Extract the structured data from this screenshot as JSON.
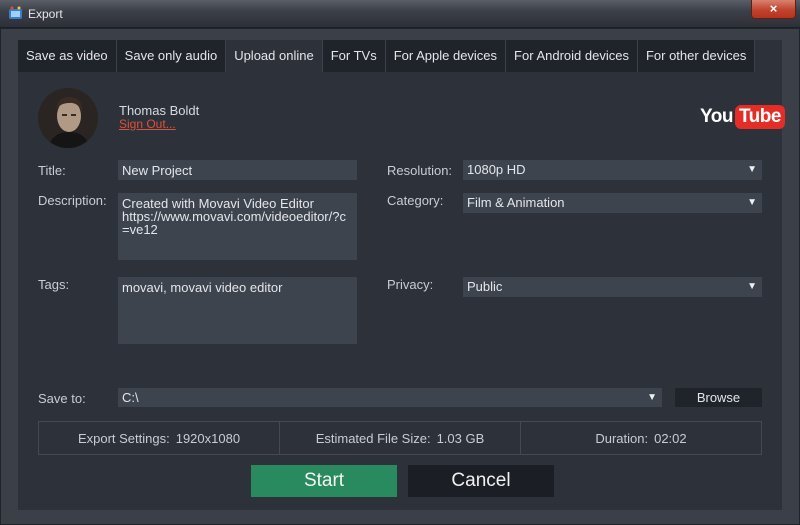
{
  "window": {
    "title": "Export",
    "close_symbol": "×"
  },
  "tabs": [
    {
      "label": "Save as video",
      "active": false
    },
    {
      "label": "Save only audio",
      "active": false
    },
    {
      "label": "Upload online",
      "active": true
    },
    {
      "label": "For TVs",
      "active": false
    },
    {
      "label": "For Apple devices",
      "active": false
    },
    {
      "label": "For Android devices",
      "active": false
    },
    {
      "label": "For other devices",
      "active": false
    }
  ],
  "account": {
    "name": "Thomas Boldt",
    "sign_out": "Sign Out..."
  },
  "service": {
    "logo_you": "You",
    "logo_tube": "Tube"
  },
  "form": {
    "title_label": "Title:",
    "title_value": "New Project",
    "description_label": "Description:",
    "description_value": "Created with Movavi Video Editor\nhttps://www.movavi.com/videoeditor/?c=ve12",
    "tags_label": "Tags:",
    "tags_value": "movavi, movavi video editor",
    "resolution_label": "Resolution:",
    "resolution_value": "1080p HD",
    "category_label": "Category:",
    "category_value": "Film & Animation",
    "privacy_label": "Privacy:",
    "privacy_value": "Public",
    "save_to_label": "Save to:",
    "save_to_value": "C:\\",
    "browse_label": "Browse"
  },
  "info": {
    "export_settings_label": "Export Settings:",
    "export_settings_value": "1920x1080",
    "file_size_label": "Estimated File Size:",
    "file_size_value": "1.03 GB",
    "duration_label": "Duration:",
    "duration_value": "02:02"
  },
  "buttons": {
    "start": "Start",
    "cancel": "Cancel"
  },
  "colors": {
    "accent_green": "#2a8a5f",
    "link_red": "#e0503a",
    "youtube_red": "#e52d27"
  }
}
